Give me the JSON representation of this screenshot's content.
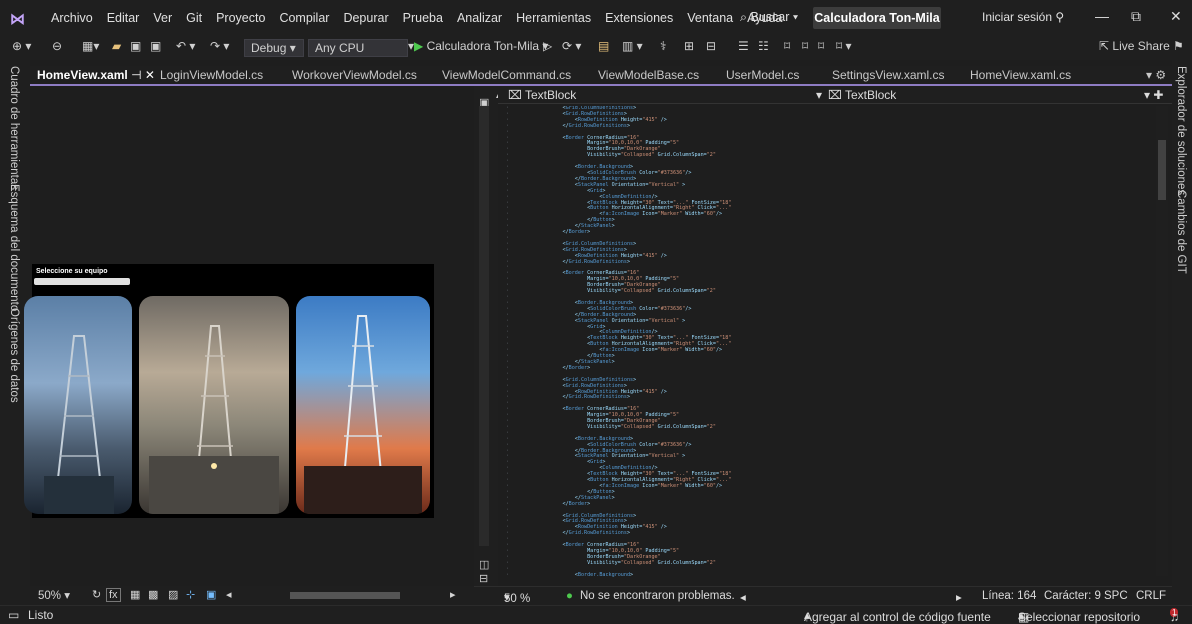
{
  "menubar": {
    "items": [
      "Archivo",
      "Editar",
      "Ver",
      "Git",
      "Proyecto",
      "Compilar",
      "Depurar",
      "Prueba",
      "Analizar",
      "Herramientas",
      "Extensiones",
      "Ventana",
      "Ayuda"
    ],
    "search": "Buscar",
    "solution_title": "Calculadora Ton-Mila",
    "sign_in": "Iniciar sesión"
  },
  "toolbar": {
    "config": "Debug",
    "platform": "Any CPU",
    "run_target": "Calculadora Ton-Mila",
    "live_share": "Live Share"
  },
  "left_tool_windows": [
    "Cuadro de herramientas",
    "Esquema del documento",
    "Orígenes de datos"
  ],
  "right_tool_windows": [
    "Explorador de soluciones",
    "Cambios de GIT"
  ],
  "tabs": [
    {
      "label": "HomeView.xaml",
      "active": true
    },
    {
      "label": "LoginViewModel.cs"
    },
    {
      "label": "WorkoverViewModel.cs"
    },
    {
      "label": "ViewModelCommand.cs"
    },
    {
      "label": "ViewModelBase.cs"
    },
    {
      "label": "UserModel.cs"
    },
    {
      "label": "SettingsView.xaml.cs"
    },
    {
      "label": "HomeView.xaml.cs"
    }
  ],
  "designer": {
    "preview_label": "Seleccione su equipo",
    "zoom": "50%"
  },
  "editor": {
    "nav_left": "TextBlock",
    "nav_right": "TextBlock",
    "zoom": "50 %",
    "issues": "No se encontraron problemas.",
    "line": "Línea: 164",
    "col": "Carácter: 9",
    "spc": "SPC",
    "eol": "CRLF"
  },
  "statusbar": {
    "ready": "Listo",
    "source_control": "Agregar al control de código fuente",
    "repo": "Seleccionar repositorio",
    "notifications": "1"
  },
  "colors": {
    "accent": "#8e7cc3",
    "bg": "#1e1e1e",
    "chrome": "#1f1f1f"
  }
}
